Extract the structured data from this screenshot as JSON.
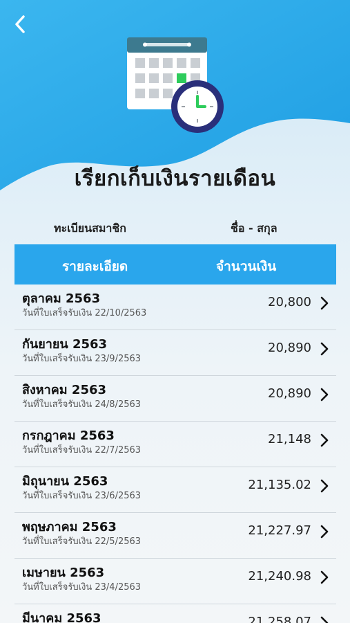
{
  "header": {
    "title": "เรียกเก็บเงินรายเดือน"
  },
  "icons": {
    "back": "chevron-left-icon",
    "calendar": "calendar-clock-icon",
    "row": "chevron-right-icon"
  },
  "member": {
    "id_label": "ทะเบียนสมาชิก",
    "name_label": "ชื่อ - สกุล"
  },
  "table": {
    "col_detail": "รายละเอียด",
    "col_amount": "จำนวนเงิน"
  },
  "colors": {
    "accent": "#2aa6ec",
    "hero": "#29aae8",
    "calendar_header": "#3d7a8f",
    "clock_ring": "#2a2f7a"
  },
  "rows": [
    {
      "month": "ตุลาคม 2563",
      "receipt": "วันที่ใบเสร็จรับเงิน 22/10/2563",
      "amount": "20,800"
    },
    {
      "month": "กันยายน 2563",
      "receipt": "วันที่ใบเสร็จรับเงิน 23/9/2563",
      "amount": "20,890"
    },
    {
      "month": "สิงหาคม 2563",
      "receipt": "วันที่ใบเสร็จรับเงิน 24/8/2563",
      "amount": "20,890"
    },
    {
      "month": "กรกฎาคม 2563",
      "receipt": "วันที่ใบเสร็จรับเงิน 22/7/2563",
      "amount": "21,148"
    },
    {
      "month": "มิถุนายน 2563",
      "receipt": "วันที่ใบเสร็จรับเงิน 23/6/2563",
      "amount": "21,135.02"
    },
    {
      "month": "พฤษภาคม 2563",
      "receipt": "วันที่ใบเสร็จรับเงิน 22/5/2563",
      "amount": "21,227.97"
    },
    {
      "month": "เมษายน 2563",
      "receipt": "วันที่ใบเสร็จรับเงิน 23/4/2563",
      "amount": "21,240.98"
    },
    {
      "month": "มีนาคม 2563",
      "receipt": "",
      "amount": "21,258.07"
    }
  ]
}
